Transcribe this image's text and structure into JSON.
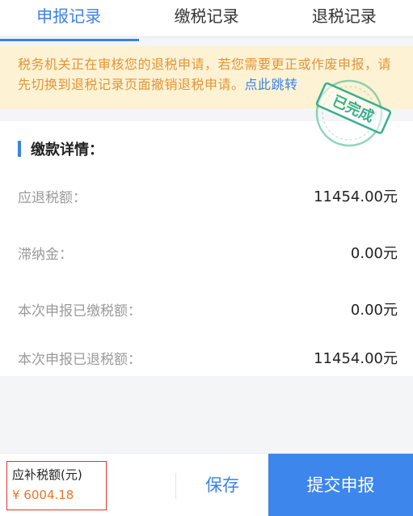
{
  "tabs": [
    {
      "label": "申报记录",
      "active": true
    },
    {
      "label": "缴税记录",
      "active": false
    },
    {
      "label": "退税记录",
      "active": false
    }
  ],
  "notice": {
    "text": "税务机关正在审核您的退税申请，若您需要更正或作废申报，请先切换到退税记录页面撤销退税申请。",
    "link": "点此跳转"
  },
  "stamp": {
    "text": "已完成",
    "color": "#3aae8c"
  },
  "details": {
    "title": "缴款详情：",
    "rows": [
      {
        "label": "应退税额：",
        "value": "11454.00元"
      },
      {
        "label": "滞纳金：",
        "value": "0.00元"
      },
      {
        "label": "本次申报已缴税额：",
        "value": "0.00元"
      },
      {
        "label": "本次申报已退税额：",
        "value": "11454.00元"
      }
    ]
  },
  "footer": {
    "supp_label": "应补税额(元)",
    "supp_amount": "¥ 6004.18",
    "save_label": "保存",
    "submit_label": "提交申报"
  },
  "colors": {
    "accent": "#3b82e8",
    "notice_bg": "#fdf3d4",
    "notice_text": "#e2943a",
    "amount": "#e8762a",
    "highlight_border": "#e0342f"
  }
}
